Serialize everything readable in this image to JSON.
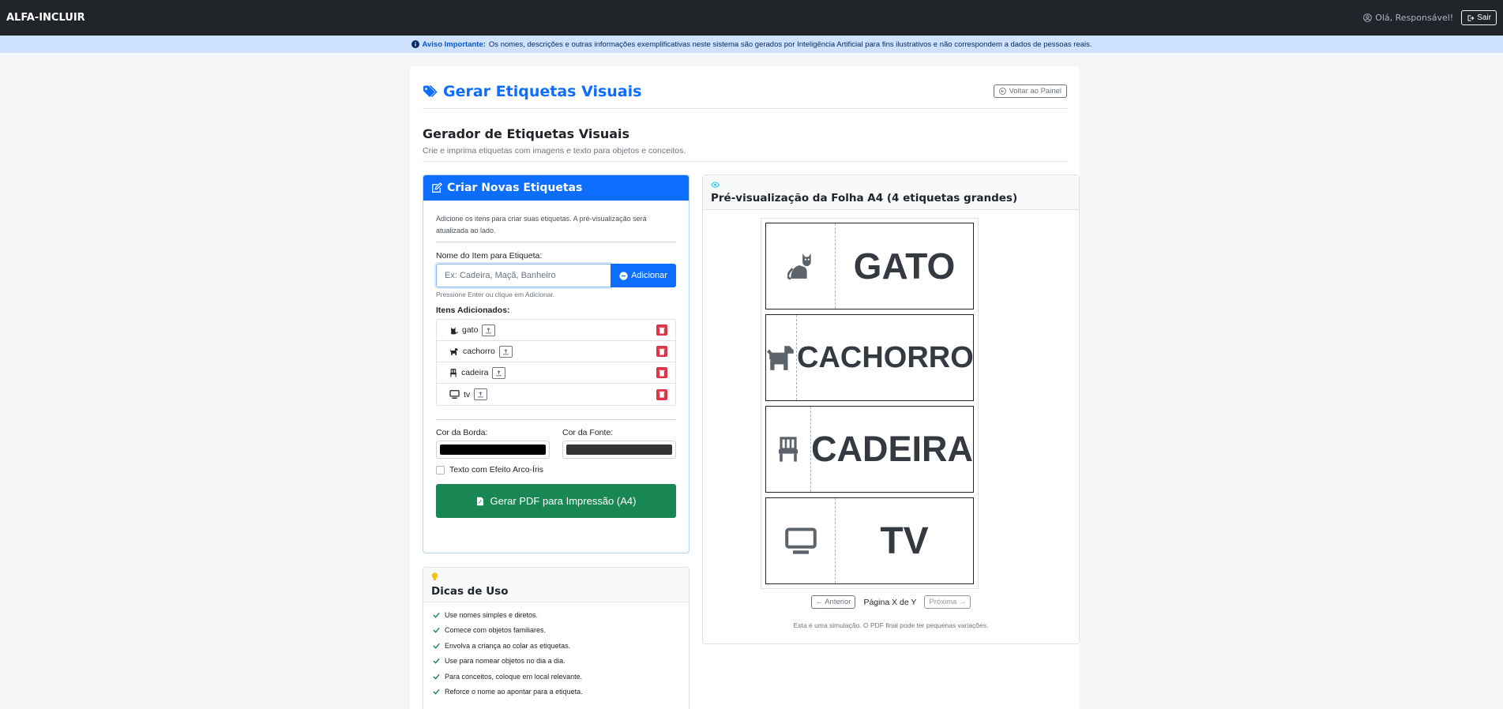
{
  "app": {
    "brand": "ALFA-INCLUIR"
  },
  "navbar": {
    "greeting": "Olá, Responsável!",
    "logout_label": "Sair"
  },
  "notice": {
    "label": "Aviso Importante:",
    "text": "Os nomes, descrições e outras informações exemplificativas neste sistema são gerados por Inteligência Artificial para fins ilustrativos e não correspondem a dados de pessoas reais."
  },
  "page": {
    "title": "Gerar Etiquetas Visuais",
    "back_label": "Voltar ao Painel",
    "section_title": "Gerador de Etiquetas Visuais",
    "section_subtitle": "Crie e imprima etiquetas com imagens e texto para objetos e conceitos."
  },
  "create": {
    "header": "Criar Novas Etiquetas",
    "help": "Adicione os itens para criar suas etiquetas. A pré-visualização será atualizada ao lado.",
    "field_label": "Nome do Item para Etiqueta:",
    "input_placeholder": "Ex: Cadeira, Maçã, Banheiro",
    "add_label": "Adicionar",
    "input_hint": "Pressione Enter ou clique em Adicionar.",
    "items_label": "Itens Adicionados:",
    "items": [
      {
        "name": "gato",
        "icon": "cat-icon"
      },
      {
        "name": "cachorro",
        "icon": "dog-icon"
      },
      {
        "name": "cadeira",
        "icon": "chair-icon"
      },
      {
        "name": "tv",
        "icon": "tv-icon"
      }
    ],
    "border_color_label": "Cor da Borda:",
    "font_color_label": "Cor da Fonte:",
    "border_color": "#000000",
    "font_color": "#333333",
    "rainbow_label": "Texto com Efeito Arco-Íris",
    "rainbow_checked": false,
    "pdf_label": "Gerar PDF para Impressão (A4)"
  },
  "tips": {
    "title": "Dicas de Uso",
    "items": [
      "Use nomes simples e diretos.",
      "Comece com objetos familiares.",
      "Envolva a criança ao colar as etiquetas.",
      "Use para nomear objetos no dia a dia.",
      "Para conceitos, coloque em local relevante.",
      "Reforce o nome ao apontar para a etiqueta."
    ]
  },
  "preview": {
    "title": "Pré-visualização da Folha A4 (4 etiquetas grandes)",
    "labels": [
      {
        "text": "GATO",
        "icon": "cat-icon"
      },
      {
        "text": "CACHORRO",
        "icon": "dog-icon"
      },
      {
        "text": "CADEIRA",
        "icon": "chair-icon"
      },
      {
        "text": "TV",
        "icon": "tv-icon"
      }
    ],
    "prev_label": "← Anterior",
    "page_indicator": "Página X de Y",
    "next_label": "Próxima →",
    "note": "Esta é uma simulação. O PDF final pode ter pequenas variações."
  },
  "colors": {
    "navbar": "#212529",
    "primary": "#0d6efd",
    "success": "#198754",
    "danger": "#dc3545",
    "notice_bg": "#cfe2ff",
    "tip_bulb": "#ffc107",
    "preview_eye": "#0dcaf0"
  }
}
